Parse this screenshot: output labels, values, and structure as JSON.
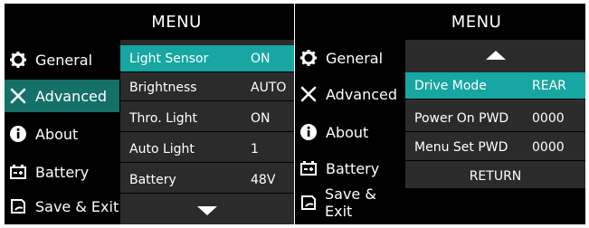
{
  "screens": [
    {
      "title": "MENU",
      "sidebar": [
        {
          "label": "General",
          "icon": "gear-icon"
        },
        {
          "label": "Advanced",
          "icon": "tools-icon",
          "active": true
        },
        {
          "label": "About",
          "icon": "info-icon"
        },
        {
          "label": "Battery",
          "icon": "battery-icon"
        },
        {
          "label": "Save & Exit",
          "icon": "save-exit-icon"
        }
      ],
      "rows": [
        {
          "label": "Light Sensor",
          "value": "ON",
          "selected": true
        },
        {
          "label": "Brightness",
          "value": "AUTO"
        },
        {
          "label": "Thro. Light",
          "value": "ON"
        },
        {
          "label": "Auto Light",
          "value": "1"
        },
        {
          "label": "Battery",
          "value": "48V"
        }
      ],
      "scroll_down_icon": "chevron-down-icon"
    },
    {
      "title": "MENU",
      "sidebar": [
        {
          "label": "General",
          "icon": "gear-icon"
        },
        {
          "label": "Advanced",
          "icon": "tools-icon",
          "active": true
        },
        {
          "label": "About",
          "icon": "info-icon"
        },
        {
          "label": "Battery",
          "icon": "battery-icon"
        },
        {
          "label": "Save & Exit",
          "icon": "save-exit-icon"
        }
      ],
      "rows": [
        {
          "label": "Drive Mode",
          "value": "REAR",
          "selected": true
        },
        {
          "label": "Power On PWD",
          "value": "0000"
        },
        {
          "label": "Menu Set PWD",
          "value": "0000"
        }
      ],
      "return_label": "RETURN",
      "scroll_up_icon": "chevron-up-icon"
    }
  ],
  "colors": {
    "active_nav": "#15706a",
    "selected_row": "#17a6a1",
    "panel": "#2b2b2b",
    "background": "#000000"
  }
}
